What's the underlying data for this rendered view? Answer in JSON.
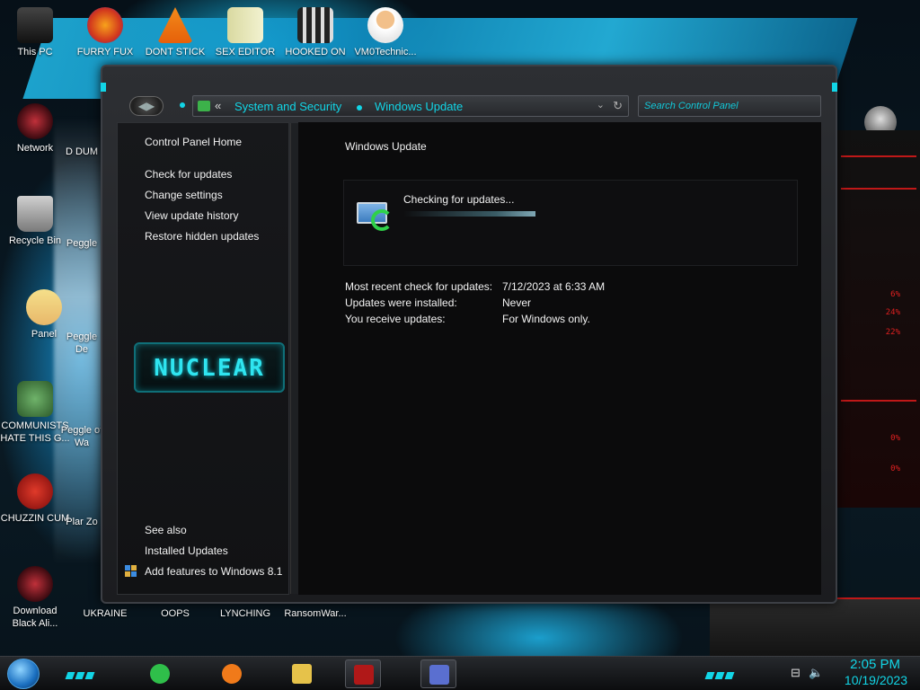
{
  "desktop": {
    "icons_top": [
      {
        "label": "This PC"
      },
      {
        "label": "FURRY FUX"
      },
      {
        "label": "DONT STICK"
      },
      {
        "label": "SEX EDITOR"
      },
      {
        "label": "HOOKED ON"
      },
      {
        "label": "VM0Technic..."
      }
    ],
    "icons_left": [
      {
        "label": "Network"
      },
      {
        "label": "Recycle Bin"
      },
      {
        "label": "Panel"
      },
      {
        "label": "COMMUNISTS HATE THIS G..."
      },
      {
        "label": "CHUZZIN CUM"
      },
      {
        "label": "Download Black Ali..."
      }
    ],
    "icons_second_col": [
      {
        "label": "D DUM"
      },
      {
        "label": "Peggle"
      },
      {
        "label": "Peggle De"
      },
      {
        "label": "Peggle of Wa"
      },
      {
        "label": "Plar Zo"
      },
      {
        "label": "UKRAINE"
      }
    ],
    "icons_bottom": [
      {
        "label": "OOPS"
      },
      {
        "label": "LYNCHING"
      },
      {
        "label": "RansomWar..."
      }
    ],
    "gadget_pcts": [
      "6%",
      "24%",
      "22%",
      "0%",
      "0%"
    ]
  },
  "window": {
    "breadcrumb": [
      "System and Security",
      "Windows Update"
    ],
    "back_glyph": "«",
    "search_placeholder": "Search Control Panel",
    "left_pane": {
      "home": "Control Panel Home",
      "links": [
        "Check for updates",
        "Change settings",
        "View update history",
        "Restore hidden updates"
      ],
      "logo_text": "NUCLEAR",
      "see_also_heading": "See also",
      "see_also_links": [
        "Installed Updates",
        "Add features to Windows 8.1"
      ]
    },
    "content": {
      "title": "Windows Update",
      "status": "Checking for updates...",
      "progress_fraction": 0.35,
      "info": [
        {
          "label": "Most recent check for updates:",
          "value": "7/12/2023 at 6:33 AM"
        },
        {
          "label": "Updates were installed:",
          "value": "Never"
        },
        {
          "label": "You receive updates:",
          "value": "For Windows only."
        }
      ]
    }
  },
  "taskbar": {
    "apps": [
      {
        "name": "notes-app-icon",
        "color": "#2fbf4a"
      },
      {
        "name": "firefox-icon",
        "color": "#f07a1a"
      },
      {
        "name": "file-explorer-icon",
        "color": "#e6c24a"
      },
      {
        "name": "app-window-icon",
        "color": "#b01818"
      },
      {
        "name": "control-panel-icon",
        "color": "#5a6fd0"
      }
    ],
    "time": "2:05 PM",
    "date": "10/19/2023"
  },
  "colors": {
    "accent": "#12d5e6",
    "alert_red": "#c01818"
  }
}
